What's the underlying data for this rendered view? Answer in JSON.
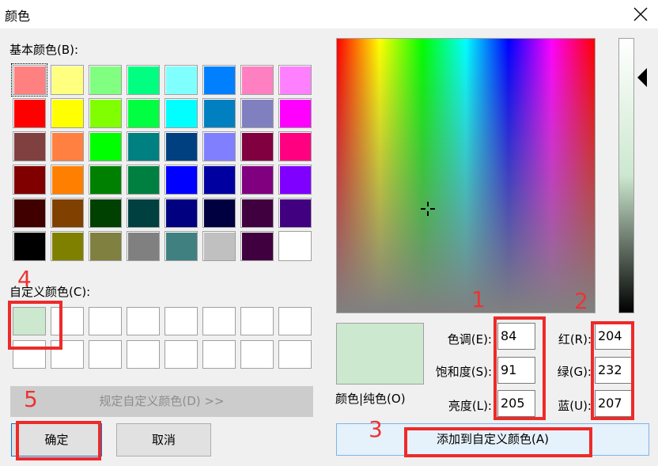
{
  "window": {
    "title": "颜色"
  },
  "basic_colors": {
    "label": "基本颜色(B):",
    "rows": [
      [
        "#ff8080",
        "#ffff80",
        "#80ff80",
        "#00ff80",
        "#80ffff",
        "#0080ff",
        "#ff80c0",
        "#ff80ff"
      ],
      [
        "#ff0000",
        "#ffff00",
        "#80ff00",
        "#00ff40",
        "#00ffff",
        "#0080c0",
        "#8080c0",
        "#ff00ff"
      ],
      [
        "#804040",
        "#ff8040",
        "#00ff00",
        "#008080",
        "#004080",
        "#8080ff",
        "#800040",
        "#ff0080"
      ],
      [
        "#800000",
        "#ff8000",
        "#008000",
        "#008040",
        "#0000ff",
        "#0000a0",
        "#800080",
        "#8000ff"
      ],
      [
        "#400000",
        "#804000",
        "#004000",
        "#004040",
        "#000080",
        "#000040",
        "#400040",
        "#400080"
      ],
      [
        "#000000",
        "#808000",
        "#808040",
        "#808080",
        "#408080",
        "#c0c0c0",
        "#400040",
        "#ffffff"
      ]
    ]
  },
  "custom_colors": {
    "label": "自定义颜色(C):",
    "first_color": "#cce8cf",
    "empty_color": "#ffffff"
  },
  "define_button": {
    "label": "规定自定义颜色(D) >>"
  },
  "ok_button": {
    "label": "确定"
  },
  "cancel_button": {
    "label": "取消"
  },
  "preview": {
    "color": "#cce8cf",
    "label": "颜色|纯色(O)"
  },
  "hsl": {
    "hue_label": "色调(E):",
    "hue": "84",
    "sat_label": "饱和度(S):",
    "sat": "91",
    "lum_label": "亮度(L):",
    "lum": "205"
  },
  "rgb": {
    "red_label": "红(R):",
    "red": "204",
    "green_label": "绿(G):",
    "green": "232",
    "blue_label": "蓝(U):",
    "blue": "207"
  },
  "add_button": {
    "label": "添加到自定义颜色(A)"
  },
  "annotations": {
    "color": "#ee2a2a",
    "numbers": [
      "1",
      "2",
      "3",
      "4",
      "5"
    ]
  }
}
